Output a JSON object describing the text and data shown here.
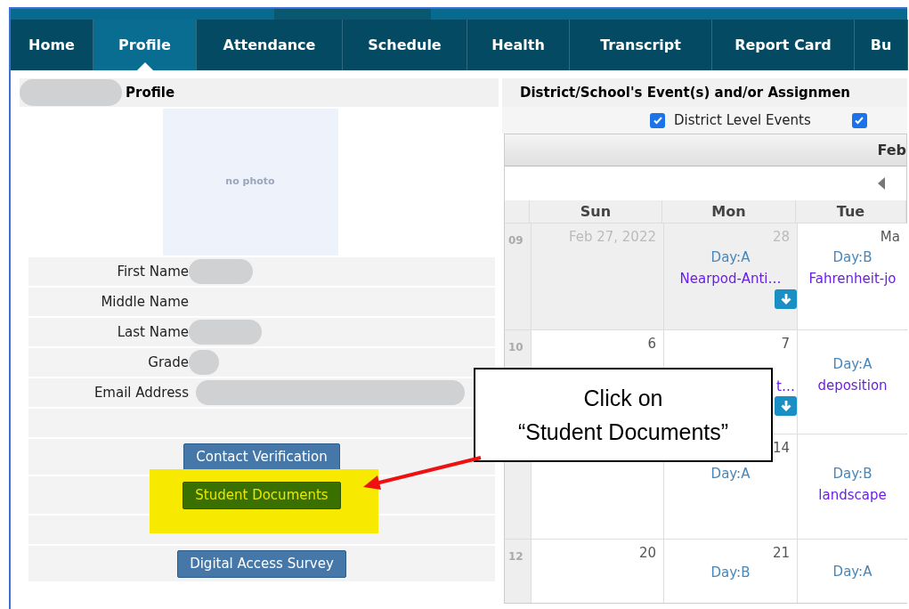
{
  "nav": [
    {
      "label": "Home",
      "selected": false
    },
    {
      "label": "Profile",
      "selected": true
    },
    {
      "label": "Attendance",
      "selected": false
    },
    {
      "label": "Schedule",
      "selected": false
    },
    {
      "label": "Health",
      "selected": false
    },
    {
      "label": "Transcript",
      "selected": false
    },
    {
      "label": "Report Card",
      "selected": false
    },
    {
      "label": "Bu",
      "selected": false
    }
  ],
  "profile": {
    "title": "Profile",
    "title_redacted": true,
    "photo_placeholder": "no photo",
    "fields": [
      {
        "label": "First Name",
        "redacted": true
      },
      {
        "label": "Middle Name",
        "redacted": false
      },
      {
        "label": "Last Name",
        "redacted": true
      },
      {
        "label": "Grade",
        "redacted": true
      },
      {
        "label": "Email Address",
        "redacted": true
      }
    ],
    "buttons": [
      {
        "label": "Contact Verification",
        "kind": "primary",
        "highlighted": false
      },
      {
        "label": "Student Documents",
        "kind": "success",
        "highlighted": true
      },
      {
        "label": "Digital Access Survey",
        "kind": "primary",
        "highlighted": false
      }
    ]
  },
  "events": {
    "title": "District/School's Event(s) and/or Assignmen",
    "filters": [
      {
        "label": "District Level Events",
        "checked": true
      },
      {
        "checked": true
      }
    ],
    "month": "Feb",
    "columns": [
      "Sun",
      "Mon",
      "Tue"
    ],
    "weeks": [
      {
        "number": "09",
        "cells": [
          {
            "date": "Feb 27, 2022",
            "muted": true
          },
          {
            "date": "28",
            "muted": true,
            "day_type": "Day:A",
            "event": "Nearpod-Anti…",
            "download": true
          },
          {
            "date": "Ma",
            "muted": false,
            "day_type": "Day:B",
            "event": "Fahrenheit-jo"
          }
        ]
      },
      {
        "number": "10",
        "cells": [
          {
            "date": "6",
            "muted": false
          },
          {
            "date": "7",
            "muted": false,
            "event": "t…",
            "download": true
          },
          {
            "muted": false,
            "day_type": "Day:A",
            "event": "deposition"
          }
        ]
      },
      {
        "cells": [
          {
            "muted": false
          },
          {
            "date": "14",
            "muted": false,
            "day_type": "Day:A"
          },
          {
            "muted": false,
            "day_type": "Day:B",
            "event": "landscape"
          }
        ]
      },
      {
        "number": "12",
        "cells": [
          {
            "date": "20",
            "muted": false
          },
          {
            "date": "21",
            "muted": false,
            "day_type": "Day:B"
          },
          {
            "muted": false,
            "day_type": "Day:A"
          }
        ]
      }
    ]
  },
  "callout": {
    "lines": [
      "Click on",
      "“Student Documents”"
    ]
  }
}
